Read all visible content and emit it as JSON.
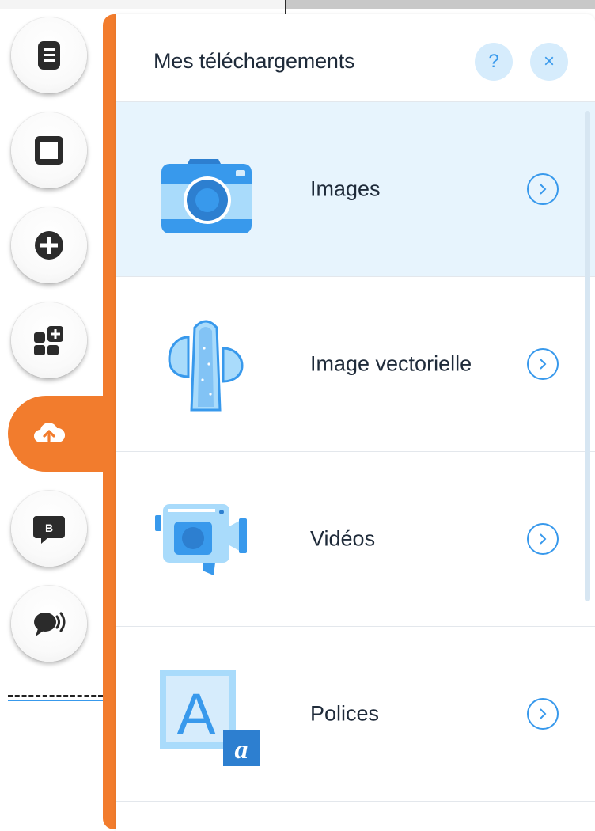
{
  "panel": {
    "title": "Mes téléchargements",
    "help_label": "?",
    "close_label": "×",
    "items": [
      {
        "label": "Images",
        "icon": "camera-icon",
        "selected": true
      },
      {
        "label": "Image vectorielle",
        "icon": "cactus-icon",
        "selected": false
      },
      {
        "label": "Vidéos",
        "icon": "video-camera-icon",
        "selected": false
      },
      {
        "label": "Polices",
        "icon": "font-icon",
        "selected": false
      }
    ],
    "font_icon_letters": {
      "big": "A",
      "small": "a"
    }
  },
  "sidebar": {
    "buttons": [
      {
        "icon": "pages-icon"
      },
      {
        "icon": "background-icon"
      },
      {
        "icon": "add-icon"
      },
      {
        "icon": "app-market-icon"
      },
      {
        "icon": "upload-icon",
        "active": true
      },
      {
        "icon": "blog-icon"
      },
      {
        "icon": "chat-icon"
      }
    ]
  },
  "colors": {
    "accent": "#f27c2d",
    "selection": "#e7f4fd",
    "link_blue": "#3899ec",
    "icon_dark": "#2b2b2b"
  }
}
